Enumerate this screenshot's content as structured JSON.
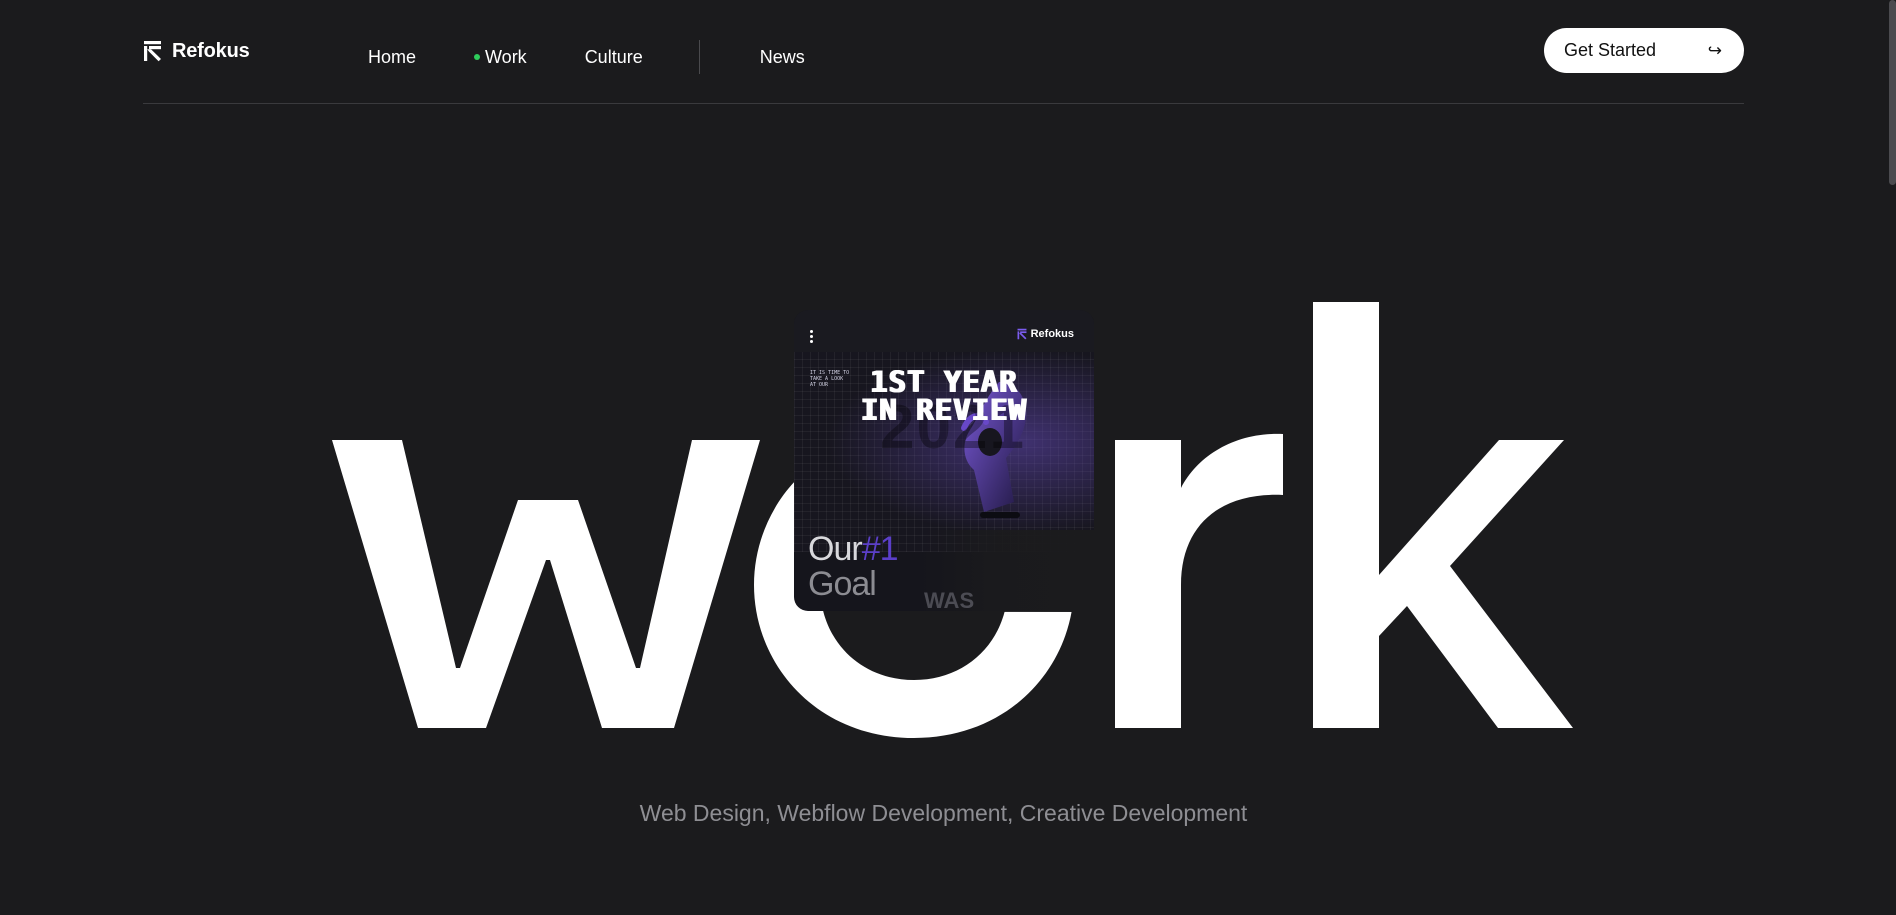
{
  "brand": {
    "name": "Refokus",
    "logo_icon": "refokus-arrow-logo-icon"
  },
  "nav": {
    "items": [
      {
        "label": "Home",
        "active": false
      },
      {
        "label": "Work",
        "active": true
      },
      {
        "label": "Culture",
        "active": false
      },
      {
        "label": "News",
        "active": false
      }
    ],
    "active_indicator_color": "#2ecc5b"
  },
  "cta": {
    "label": "Get Started",
    "icon": "arrow-return-right-icon"
  },
  "hero": {
    "title": "work",
    "card": {
      "brand": "Refokus",
      "menu_icon": "vertical-dots-icon",
      "headline_line1": "1ST YEAR",
      "headline_line2": "IN REVIEW",
      "ghost_year": "2021",
      "small_text": "IT IS TIME TO TAKE A LOOK AT OUR",
      "goal_word1": "Our",
      "goal_hash": "#1",
      "goal_word2": "Goal",
      "was_text": "WAS"
    },
    "subtitle": "Web Design, Webflow Development, Creative Development"
  },
  "colors": {
    "background": "#1b1b1d",
    "text": "#ffffff",
    "muted": "#8e8e93",
    "accent_purple": "#5b3fc9"
  }
}
